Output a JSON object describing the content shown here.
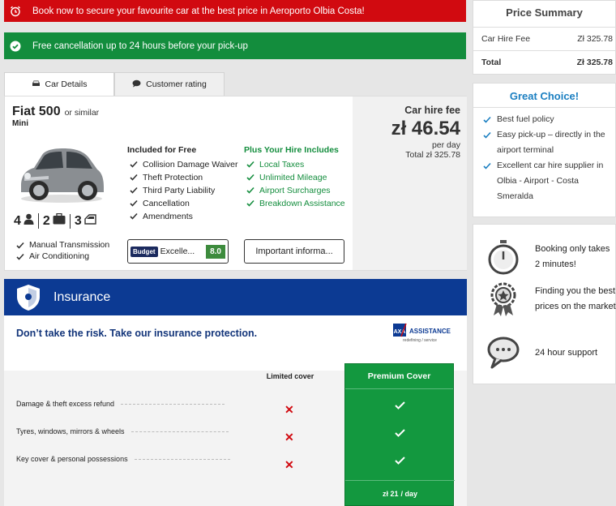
{
  "banners": {
    "booking": "Book now to secure your favourite car at the best price in Aeroporto Olbia Costa!",
    "cancellation": "Free cancellation up to 24 hours before your pick-up"
  },
  "tabs": [
    {
      "label": "Car Details",
      "icon": "car-icon",
      "active": true
    },
    {
      "label": "Customer rating",
      "icon": "chat-icon",
      "active": false
    }
  ],
  "car": {
    "name": "Fiat 500",
    "similar": "or similar",
    "class": "Mini",
    "seats": "4",
    "bags": "2",
    "doors": "3",
    "features": [
      "Manual Transmission",
      "Air Conditioning"
    ],
    "included_title": "Included for Free",
    "included": [
      "Collision Damage Waiver",
      "Theft Protection",
      "Third Party Liability",
      "Cancellation",
      "Amendments"
    ],
    "plus_title": "Plus Your Hire Includes",
    "plus": [
      "Local Taxes",
      "Unlimited Mileage",
      "Airport Surcharges",
      "Breakdown Assistance"
    ],
    "supplier_logo": "Budget",
    "rating_text": "Excelle...",
    "rating_score": "8.0",
    "info_button": "Important informa...",
    "fee_label": "Car hire fee",
    "fee_amount": "zł 46.54",
    "per_day": "per day",
    "total": "Total zł 325.78"
  },
  "insurance": {
    "title": "Insurance",
    "tagline": "Don’t take the risk. Take our insurance protection.",
    "provider_name": "ASSISTANCE",
    "provider_tagline": "redefining / service",
    "limited_label": "Limited cover",
    "premium_label": "Premium Cover",
    "rows": [
      "Damage & theft excess refund",
      "Tyres, windows, mirrors & wheels",
      "Key cover & personal possessions"
    ],
    "premium_price": "zł 21",
    "premium_per": "/ day"
  },
  "summary": {
    "title": "Price Summary",
    "rows": [
      {
        "label": "Car Hire Fee",
        "value": "Zł 325.78"
      },
      {
        "label": "Total",
        "value": "Zł 325.78"
      }
    ]
  },
  "great_choice": {
    "title": "Great Choice!",
    "items": [
      "Best fuel policy",
      "Easy pick-up – directly in the airport terminal",
      "Excellent car hire supplier in Olbia - Airport - Costa Smeralda"
    ]
  },
  "benefits": [
    {
      "text": "Booking only takes 2 minutes!",
      "icon": "stopwatch-icon"
    },
    {
      "text": "Finding you the best prices on the market",
      "icon": "award-badge-icon"
    },
    {
      "text": "24 hour support",
      "icon": "speech-bubble-icon"
    }
  ],
  "colors": {
    "red": "#d10a10",
    "green": "#138d3d",
    "navy": "#0c3a93",
    "blue_title": "#1b7fc1"
  }
}
